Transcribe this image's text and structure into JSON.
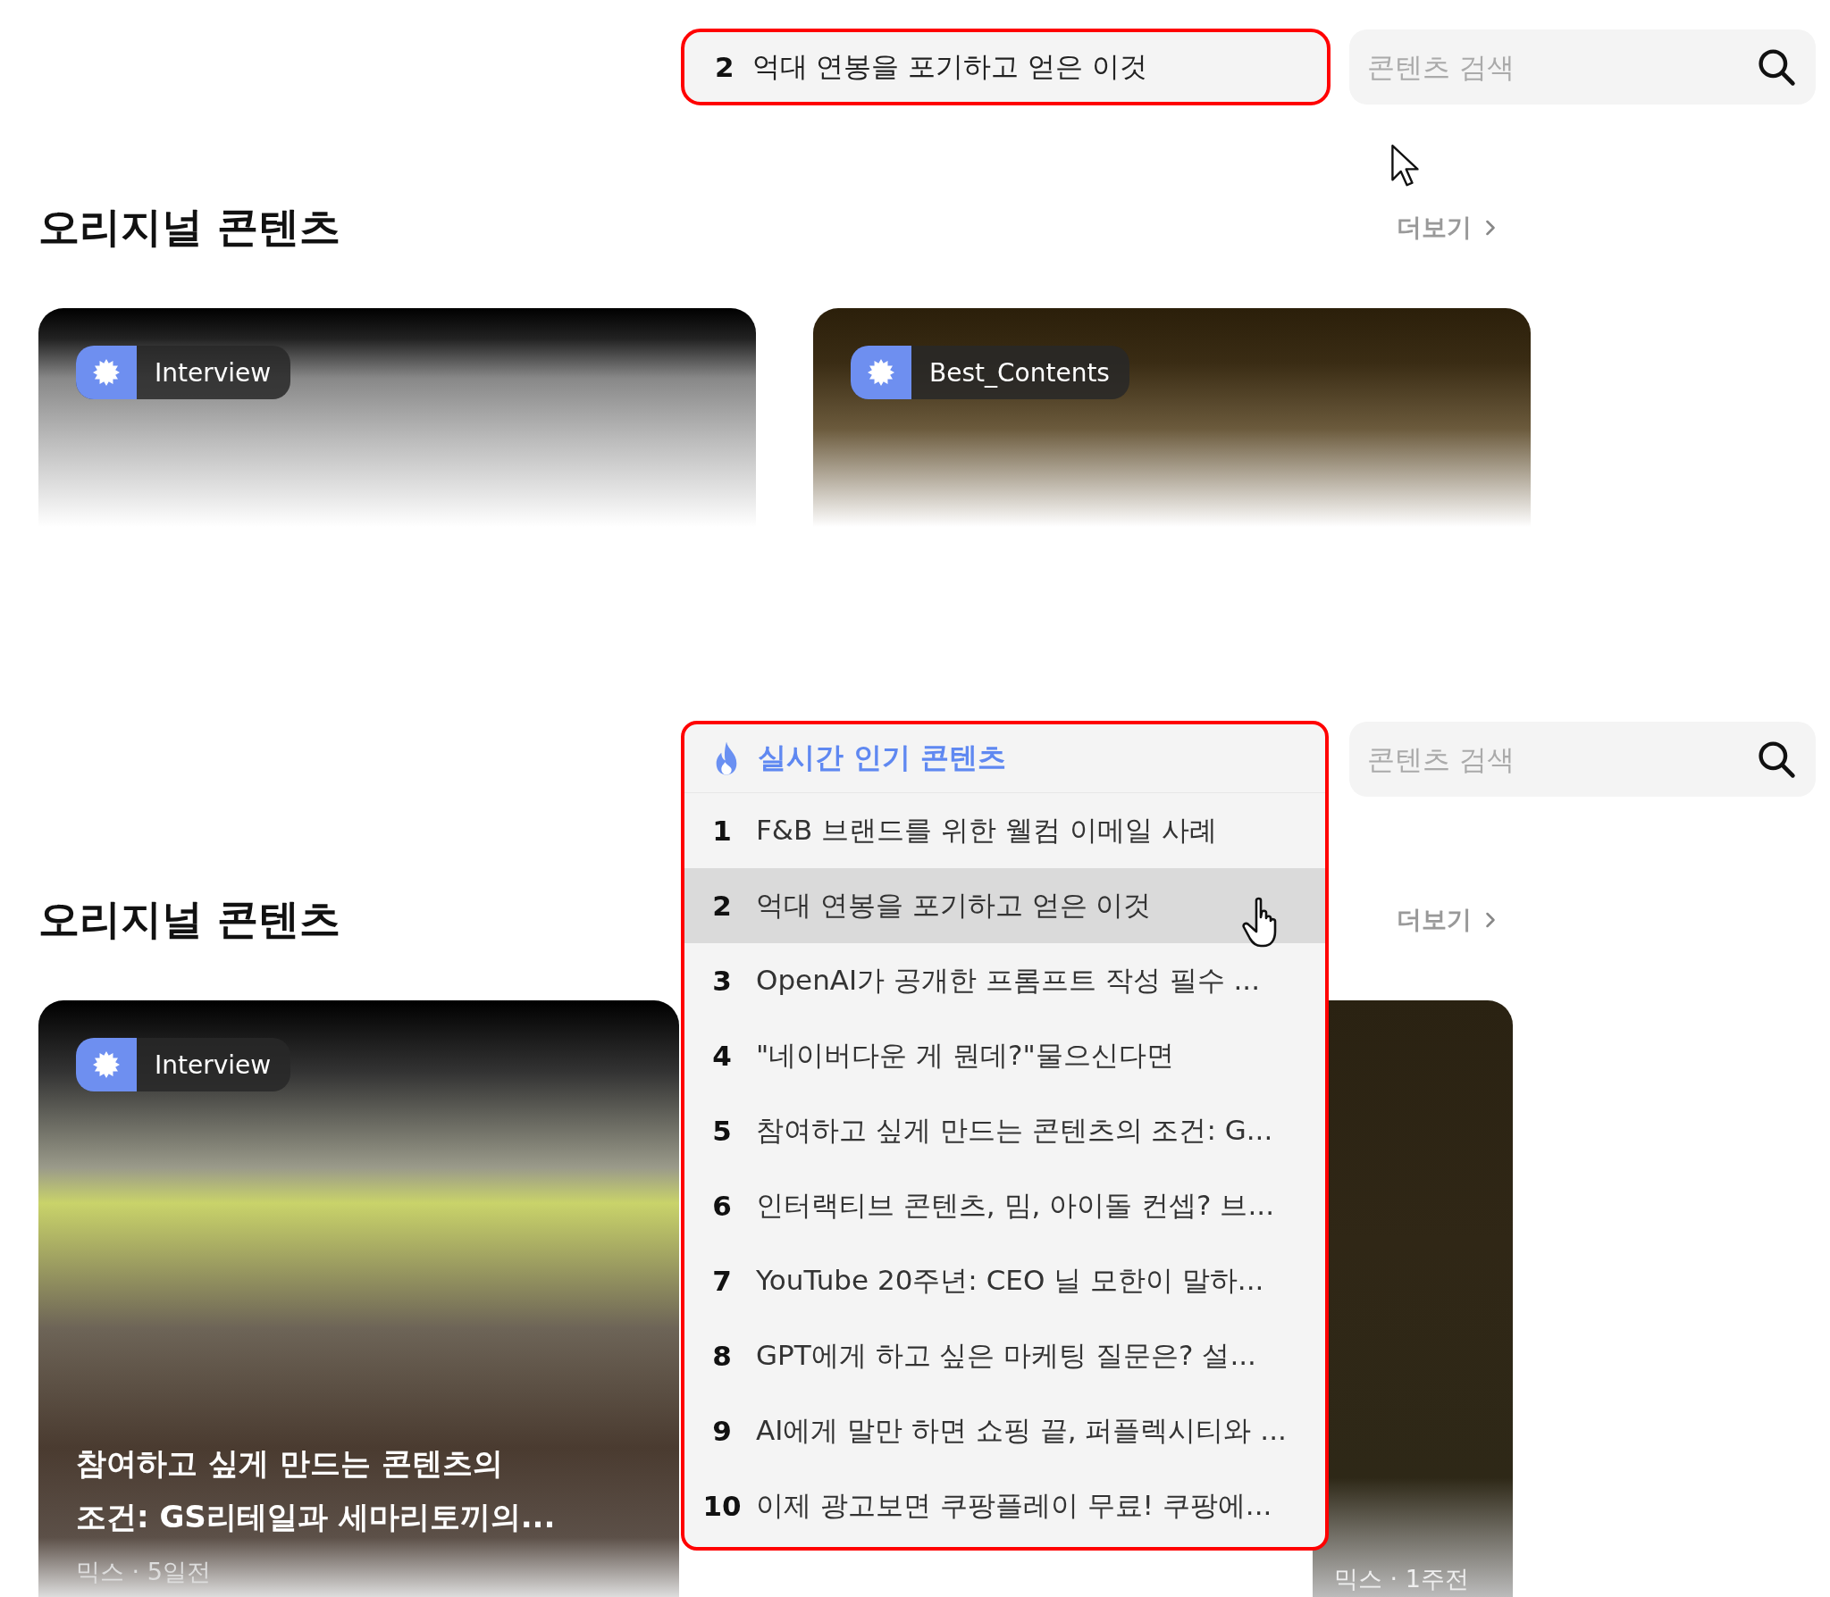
{
  "panels": [
    {
      "rolling_keyword": {
        "rank": "2",
        "title": "억대 연봉을 포기하고 얻은 이것"
      },
      "search": {
        "placeholder": "콘텐츠 검색"
      },
      "section": {
        "title": "오리지널 콘텐츠",
        "more": "더보기"
      },
      "cards": [
        {
          "tag": "Interview"
        },
        {
          "tag": "Best_Contents"
        }
      ]
    },
    {
      "popular": {
        "title": "실시간 인기 콘텐츠",
        "items": [
          {
            "rank": "1",
            "title": "F&B 브랜드를 위한 웰컴 이메일 사례",
            "selected": false
          },
          {
            "rank": "2",
            "title": "억대 연봉을 포기하고 얻은 이것",
            "selected": true
          },
          {
            "rank": "3",
            "title": "OpenAI가 공개한 프롬프트 작성 필수 ...",
            "selected": false
          },
          {
            "rank": "4",
            "title": "\"네이버다운 게 뭔데?\"물으신다면",
            "selected": false
          },
          {
            "rank": "5",
            "title": "참여하고 싶게 만드는 콘텐츠의 조건: G...",
            "selected": false
          },
          {
            "rank": "6",
            "title": "인터랙티브 콘텐츠, 밈, 아이돌 컨셉? 브...",
            "selected": false
          },
          {
            "rank": "7",
            "title": "YouTube 20주년: CEO 닐 모한이 말하...",
            "selected": false
          },
          {
            "rank": "8",
            "title": "GPT에게 하고 싶은 마케팅 질문은? 설...",
            "selected": false
          },
          {
            "rank": "9",
            "title": "AI에게 말만 하면 쇼핑 끝, 퍼플렉시티와 ...",
            "selected": false
          },
          {
            "rank": "10",
            "title": "이제 광고보면 쿠팡플레이 무료! 쿠팡에...",
            "selected": false
          }
        ]
      },
      "search": {
        "placeholder": "콘텐츠 검색"
      },
      "section": {
        "title": "오리지널 콘텐츠",
        "more": "더보기"
      },
      "cards": [
        {
          "tag": "Interview",
          "title": "참여하고 싶게 만드는 콘텐츠의\n조건: GS리테일과 세마리토끼의...",
          "meta": "믹스 · 5일전"
        },
        {
          "meta": "믹스 · 1주전"
        }
      ]
    }
  ]
}
